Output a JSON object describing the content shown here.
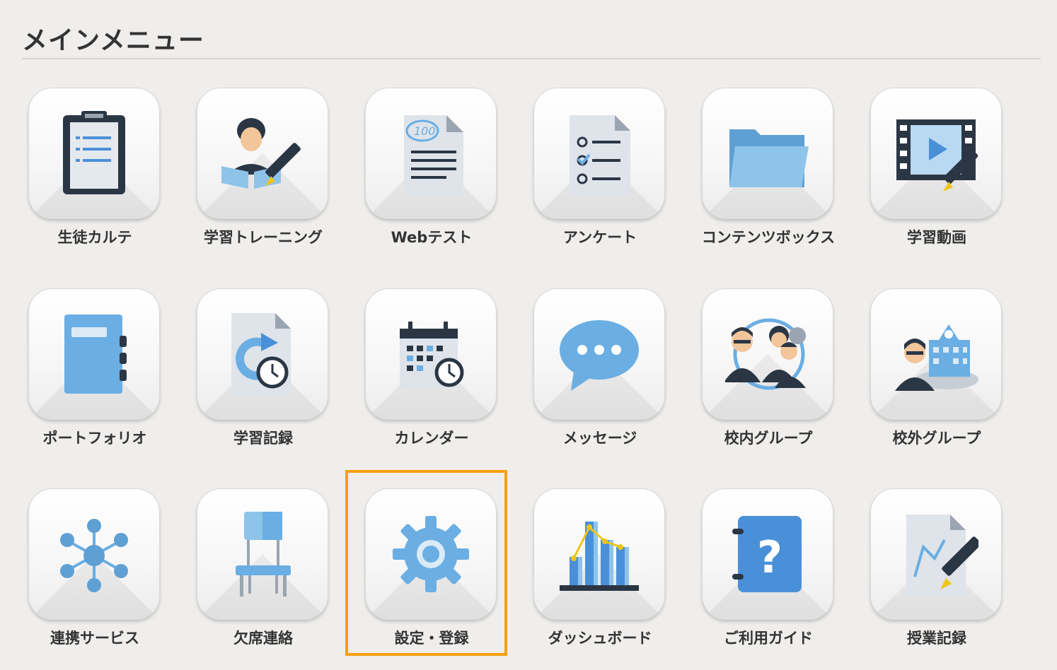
{
  "page": {
    "title": "メインメニュー",
    "highlight_color": "#f4a014"
  },
  "menu": {
    "items": [
      {
        "label": "生徒カルテ",
        "icon": "clipboard-icon"
      },
      {
        "label": "学習トレーニング",
        "icon": "student-writing-icon"
      },
      {
        "label": "Webテスト",
        "icon": "test-paper-icon"
      },
      {
        "label": "アンケート",
        "icon": "survey-checklist-icon"
      },
      {
        "label": "コンテンツボックス",
        "icon": "folder-icon"
      },
      {
        "label": "学習動画",
        "icon": "video-film-icon"
      },
      {
        "label": "ポートフォリオ",
        "icon": "notebook-icon"
      },
      {
        "label": "学習記録",
        "icon": "study-record-icon"
      },
      {
        "label": "カレンダー",
        "icon": "calendar-icon"
      },
      {
        "label": "メッセージ",
        "icon": "speech-bubble-icon"
      },
      {
        "label": "校内グループ",
        "icon": "school-group-icon"
      },
      {
        "label": "校外グループ",
        "icon": "external-group-icon"
      },
      {
        "label": "連携サービス",
        "icon": "network-hub-icon"
      },
      {
        "label": "欠席連絡",
        "icon": "chair-icon"
      },
      {
        "label": "設定・登録",
        "icon": "gear-icon"
      },
      {
        "label": "ダッシュボード",
        "icon": "bar-chart-icon"
      },
      {
        "label": "ご利用ガイド",
        "icon": "guide-book-icon"
      },
      {
        "label": "授業記録",
        "icon": "lesson-record-icon"
      }
    ]
  },
  "colors": {
    "icon_blue": "#6aaee3",
    "icon_dark": "#2b3645",
    "accent_yellow": "#f0c419"
  }
}
